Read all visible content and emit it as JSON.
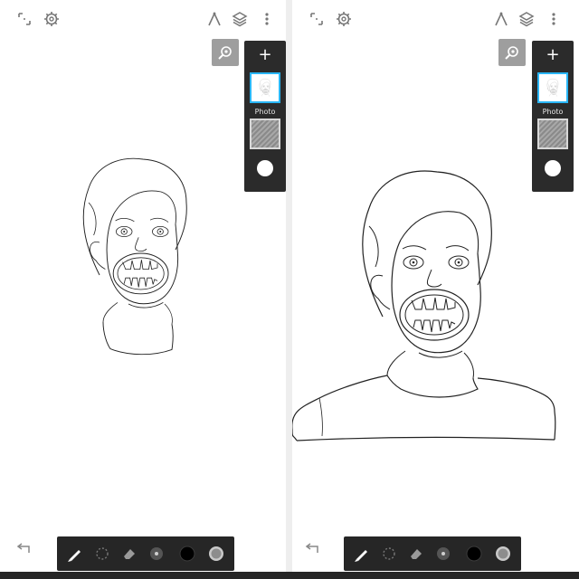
{
  "app": {
    "accent_color": "#29b6f6",
    "toolbar_color": "#262626",
    "panel_color": "#2b2b2b"
  },
  "panels": [
    {
      "id": "left",
      "top_left_icons": [
        "expand-icon",
        "gear-icon"
      ],
      "top_right_icons": [
        "ruler-icon",
        "layers-icon",
        "more-vertical-icon"
      ],
      "reference_button_icon": "reference-magnifier-icon",
      "layers_panel": {
        "add_label": "+",
        "layers": [
          {
            "label": "Photo",
            "selected": true
          },
          {
            "label": "",
            "selected": false
          }
        ],
        "current_color": "#ffffff"
      },
      "drawing": "face-only",
      "toolbar": {
        "tools": [
          "brush-icon",
          "lasso-icon",
          "eraser-icon",
          "brush-size-icon",
          "color-swatch-icon",
          "opacity-icon"
        ],
        "active_tool": "brush-icon",
        "brush_color": "#000000"
      }
    },
    {
      "id": "right",
      "top_left_icons": [
        "expand-icon",
        "gear-icon"
      ],
      "top_right_icons": [
        "ruler-icon",
        "layers-icon",
        "more-vertical-icon"
      ],
      "reference_button_icon": "reference-magnifier-icon",
      "layers_panel": {
        "add_label": "+",
        "layers": [
          {
            "label": "Photo",
            "selected": true
          },
          {
            "label": "",
            "selected": false
          }
        ],
        "current_color": "#ffffff"
      },
      "drawing": "face-with-shoulders",
      "toolbar": {
        "tools": [
          "brush-icon",
          "lasso-icon",
          "eraser-icon",
          "brush-size-icon",
          "color-swatch-icon",
          "opacity-icon"
        ],
        "active_tool": "brush-icon",
        "brush_color": "#000000"
      }
    }
  ]
}
